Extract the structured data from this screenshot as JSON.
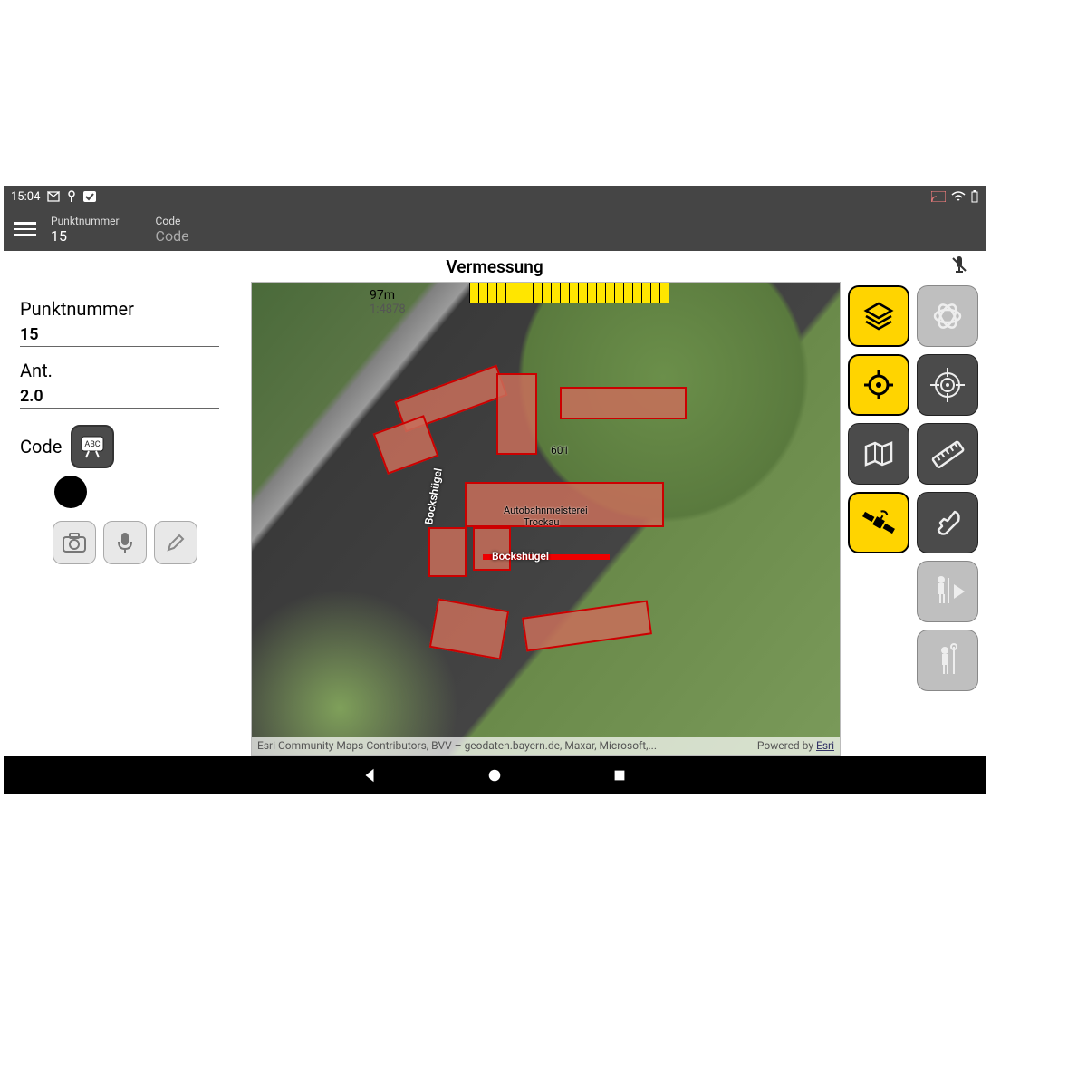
{
  "statusbar": {
    "time": "15:04"
  },
  "appbar": {
    "field1_label": "Punktnummer",
    "field1_value": "15",
    "field2_label": "Code",
    "field2_placeholder": "Code"
  },
  "title": "Vermessung",
  "sidebar": {
    "punktnummer_label": "Punktnummer",
    "punktnummer_value": "15",
    "ant_label": "Ant.",
    "ant_value": "2.0",
    "code_label": "Code"
  },
  "map": {
    "scale_distance": "97m",
    "scale_ratio": "1:4878",
    "feature_label_1": "601",
    "feature_label_2": "Autobahnmeisterei",
    "feature_label_3": "Trockau",
    "street_label": "Bockshügel",
    "attribution_text": "Esri Community Maps Contributors, BVV – geodaten.bayern.de, Maxar, Microsoft,...",
    "powered_by": "Powered by ",
    "esri": "Esri"
  },
  "colors": {
    "accent": "#ffd400",
    "dark": "#454545"
  }
}
